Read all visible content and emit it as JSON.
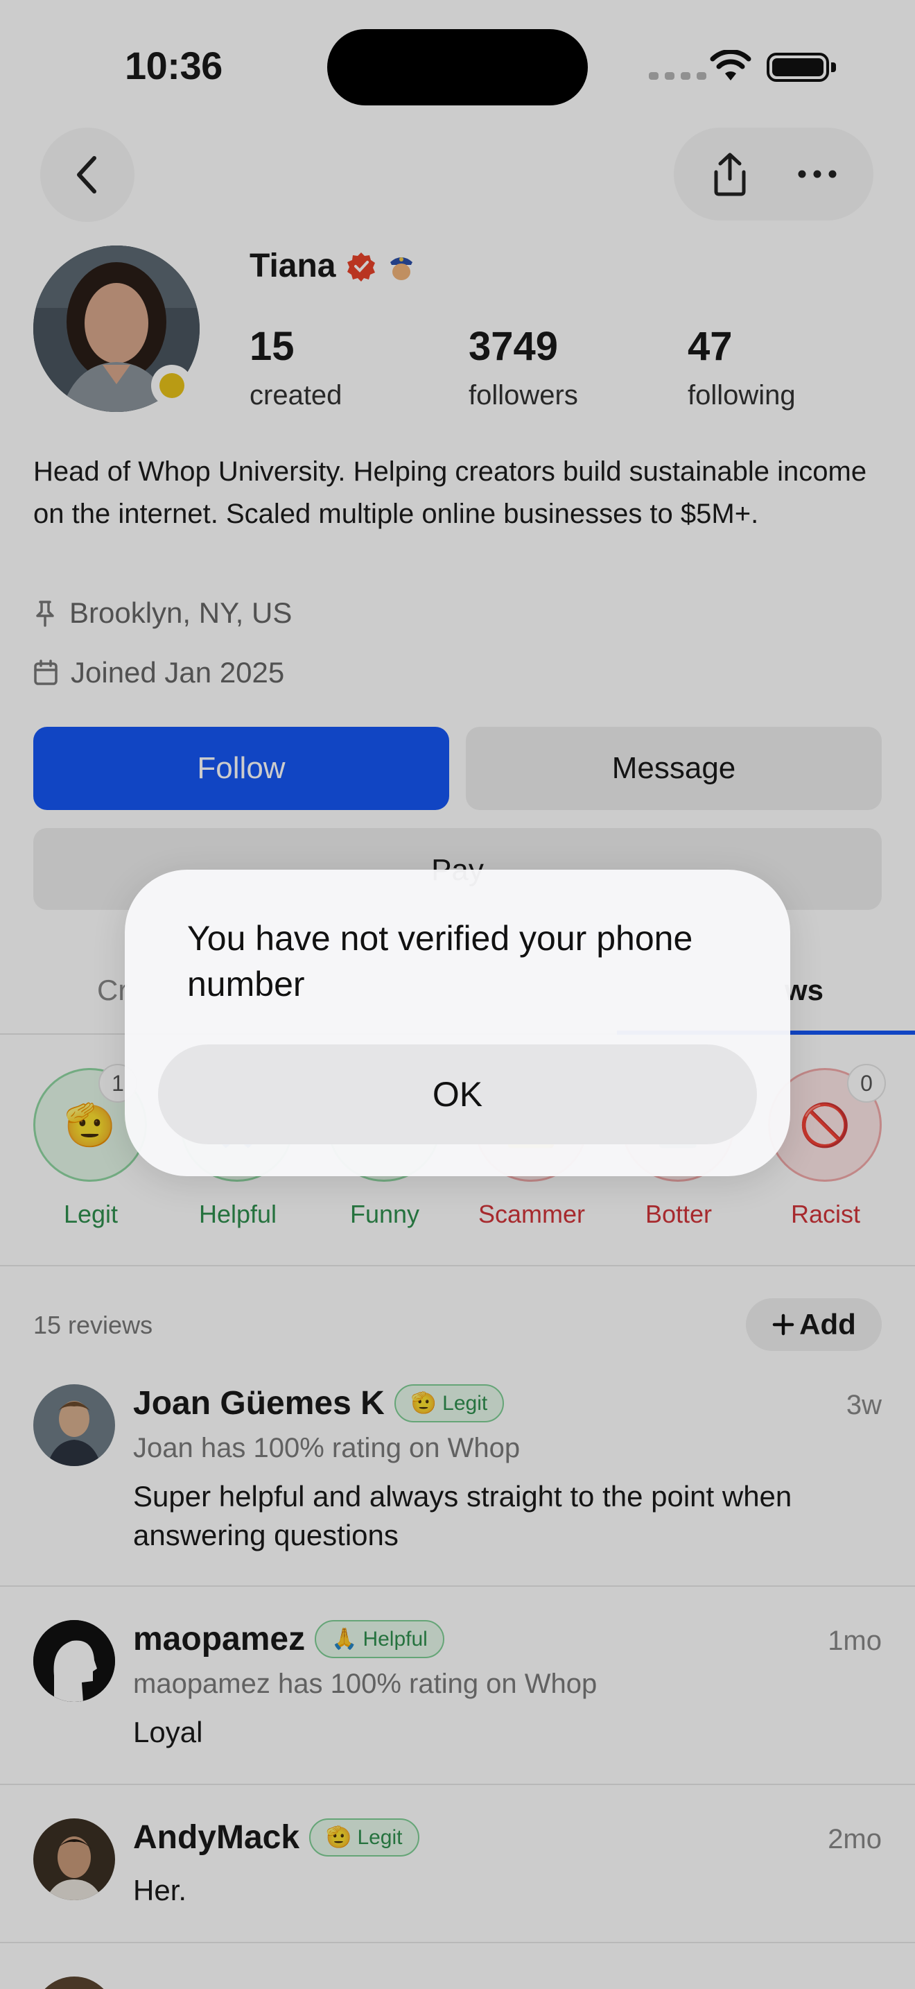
{
  "status_bar": {
    "time": "10:36"
  },
  "nav": {
    "back_icon": "chevron-left-icon",
    "share_icon": "share-icon",
    "more_icon": "more-horizontal-icon"
  },
  "profile": {
    "name": "Tiana",
    "verified_icon": "verified-badge-icon",
    "role_icon": "police-officer-icon",
    "stats": [
      {
        "value": "15",
        "label": "created"
      },
      {
        "value": "3749",
        "label": "followers"
      },
      {
        "value": "47",
        "label": "following"
      }
    ],
    "bio": "Head of Whop University. Helping creators build sustainable income on the internet. Scaled multiple online businesses to $5M+.",
    "location": "Brooklyn, NY, US",
    "joined": "Joined Jan 2025"
  },
  "actions": {
    "follow": "Follow",
    "message": "Message",
    "pay": "Pay"
  },
  "tabs": {
    "left_partial": "Cr",
    "right_partial": "ws"
  },
  "reactions": [
    {
      "emoji": "🫡",
      "label": "Legit",
      "count": "1",
      "tone": "green"
    },
    {
      "emoji": "🙏",
      "label": "Helpful",
      "tone": "green"
    },
    {
      "emoji": "😂",
      "label": "Funny",
      "tone": "green"
    },
    {
      "emoji": "⚠️",
      "label": "Scammer",
      "tone": "red"
    },
    {
      "emoji": "🤖",
      "label": "Botter",
      "tone": "red"
    },
    {
      "emoji": "🚫",
      "label": "Racist",
      "count": "0",
      "tone": "red"
    }
  ],
  "reviews_header": {
    "count_label": "15 reviews",
    "add_label": "Add"
  },
  "reviews": [
    {
      "name": "Joan Güemes K",
      "badge_emoji": "🫡",
      "badge": "Legit",
      "time": "3w",
      "sub": "Joan has 100% rating on Whop",
      "text": "Super helpful and always straight to the point when answering questions"
    },
    {
      "name": "maopamez",
      "badge_emoji": "🙏",
      "badge": "Helpful",
      "time": "1mo",
      "sub": "maopamez has 100% rating on Whop",
      "text": "Loyal"
    },
    {
      "name": "AndyMack",
      "badge_emoji": "🫡",
      "badge": "Legit",
      "time": "2mo",
      "text": "Her."
    }
  ],
  "dialog": {
    "message": "You have not verified your phone number",
    "ok": "OK"
  }
}
